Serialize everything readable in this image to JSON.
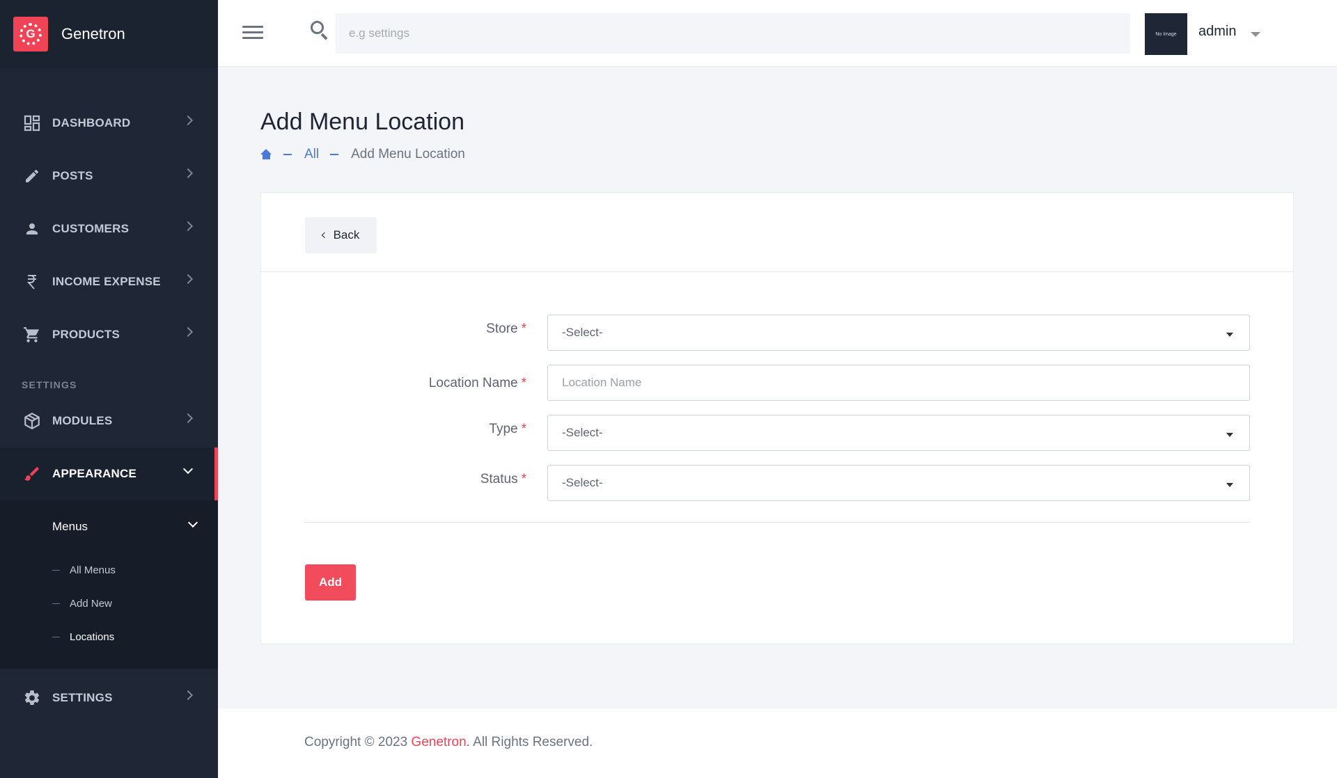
{
  "brand": {
    "name": "Genetron",
    "logo_letter": "G"
  },
  "sidebar": {
    "items": [
      {
        "label": "DASHBOARD",
        "icon": "dashboard-icon"
      },
      {
        "label": "POSTS",
        "icon": "pencil-icon"
      },
      {
        "label": "CUSTOMERS",
        "icon": "person-icon"
      },
      {
        "label": "INCOME EXPENSE",
        "icon": "rupee-icon"
      },
      {
        "label": "PRODUCTS",
        "icon": "cart-icon"
      }
    ],
    "section_label": "SETTINGS",
    "settings_items": [
      {
        "label": "MODULES",
        "icon": "cube-icon"
      },
      {
        "label": "APPEARANCE",
        "icon": "brush-icon",
        "active": true
      }
    ],
    "submenu": {
      "label": "Menus",
      "items": [
        {
          "label": "All Menus"
        },
        {
          "label": "Add New"
        },
        {
          "label": "Locations",
          "current": true
        }
      ]
    },
    "bottom_item": {
      "label": "SETTINGS",
      "icon": "gear-icon"
    }
  },
  "header": {
    "search_placeholder": "e.g settings",
    "avatar_text": "No Image",
    "username": "admin"
  },
  "page": {
    "title": "Add Menu Location",
    "breadcrumb": {
      "link": "All",
      "current": "Add Menu Location"
    }
  },
  "form": {
    "back_label": "Back",
    "fields": [
      {
        "label": "Store",
        "required": "*",
        "type": "select",
        "value": "-Select-"
      },
      {
        "label": "Location Name",
        "required": "*",
        "type": "text",
        "value": "",
        "placeholder": "Location Name"
      },
      {
        "label": "Type",
        "required": "*",
        "type": "select",
        "value": "-Select-"
      },
      {
        "label": "Status",
        "required": "*",
        "type": "select",
        "value": "-Select-"
      }
    ],
    "submit_label": "Add"
  },
  "footer": {
    "prefix": "Copyright © 2023 ",
    "brand": "Genetron",
    "suffix": ". All Rights Reserved."
  },
  "colors": {
    "accent": "#ef4456",
    "sidebar_bg": "#1f2736",
    "link": "#4a7ad9"
  }
}
